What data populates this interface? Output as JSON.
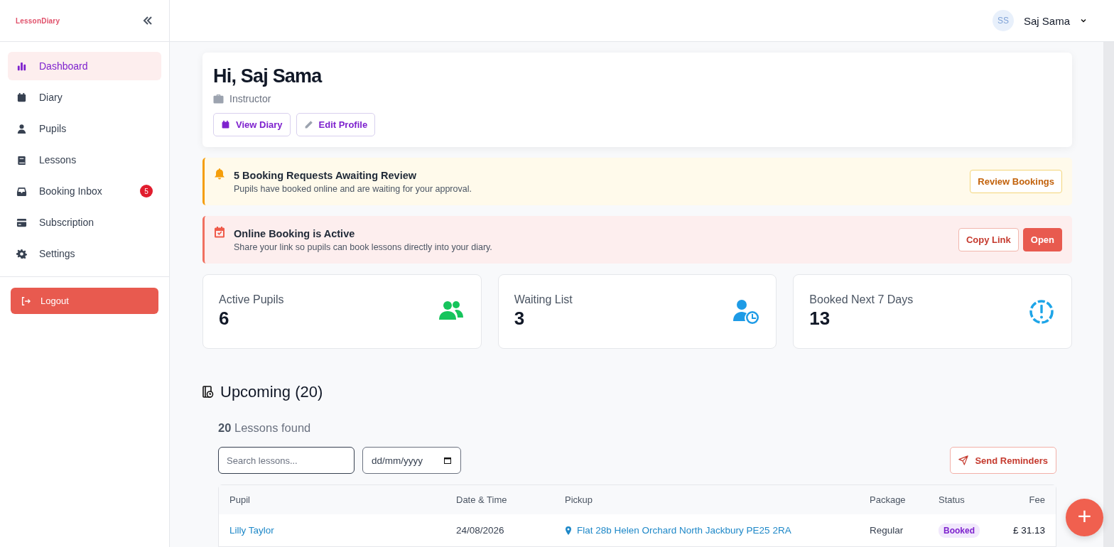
{
  "logo": {
    "text": "LessonDiary"
  },
  "sidebar": {
    "items": [
      {
        "label": "Dashboard",
        "kind": "chart",
        "selected": true
      },
      {
        "label": "Diary",
        "kind": "calendar",
        "selected": false
      },
      {
        "label": "Pupils",
        "kind": "person",
        "selected": false
      },
      {
        "label": "Lessons",
        "kind": "book",
        "selected": false
      },
      {
        "label": "Booking Inbox",
        "kind": "inbox",
        "selected": false,
        "badge": "5"
      },
      {
        "label": "Subscription",
        "kind": "card",
        "selected": false
      },
      {
        "label": "Settings",
        "kind": "gear",
        "selected": false
      }
    ],
    "logout": "Logout"
  },
  "user": {
    "initials": "SS",
    "name": "Saj Sama"
  },
  "welcome": {
    "title": "Hi, Saj Sama",
    "role": "Instructor",
    "buttons": [
      {
        "label": "View Diary",
        "kind": "calendar"
      },
      {
        "label": "Edit Profile",
        "kind": "pencil"
      }
    ]
  },
  "alerts": [
    {
      "kind": "warning",
      "title": "5 Booking Requests Awaiting Review",
      "text": "Pupils have booked online and are waiting for your approval.",
      "buttons": [
        {
          "label": "Review Bookings",
          "kind": "outline"
        }
      ]
    },
    {
      "kind": "danger",
      "title": "Online Booking is Active",
      "text": "Share your link so pupils can book lessons directly into your diary.",
      "buttons": [
        {
          "label": "Copy Link",
          "kind": "outline"
        },
        {
          "label": "Open",
          "kind": "solid"
        }
      ]
    }
  ],
  "stats": [
    {
      "label": "Active Pupils",
      "value": "6",
      "kind": "people",
      "color": "#16c45c"
    },
    {
      "label": "Waiting List",
      "value": "3",
      "kind": "person-clock",
      "color": "#1e9be6"
    },
    {
      "label": "Booked Next 7 Days",
      "value": "13",
      "kind": "alert-circle",
      "color": "#1ea5e8"
    }
  ],
  "upcoming": {
    "title": "Upcoming (20)",
    "count": "20",
    "count_label": "Lessons found",
    "search": {
      "placeholder": "Search lessons..."
    },
    "date": {
      "placeholder": "dd/mm/yyyy"
    },
    "send_button": "Send Reminders"
  },
  "table": {
    "columns": [
      "Pupil",
      "Date & Time",
      "Pickup",
      "Package",
      "Status",
      "Fee"
    ],
    "rows": [
      {
        "pupil": "Lilly Taylor",
        "date": "24/08/2026",
        "pickup": "Flat 28b Helen Orchard North Jackbury PE25 2RA",
        "package": "Regular",
        "status": "Booked",
        "fee": "£ 31.13"
      }
    ]
  },
  "fab": {
    "label": "+"
  }
}
